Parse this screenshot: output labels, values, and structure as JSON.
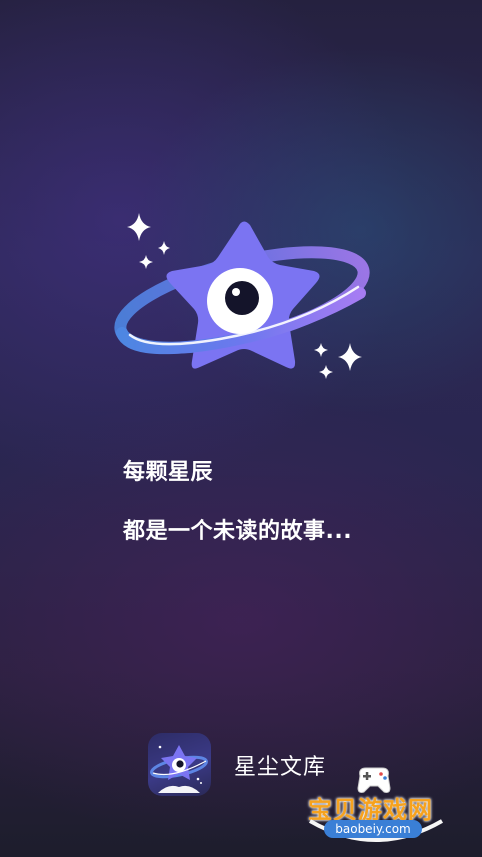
{
  "splash": {
    "tagline_line1": "每颗星辰",
    "tagline_line2": "都是一个未读的故事..."
  },
  "brand": {
    "app_name": "星尘文库"
  },
  "watermark": {
    "title": "宝贝游戏网",
    "url": "baobeiy.com"
  },
  "icons": {
    "hero": "star-planet-eye-logo",
    "app_icon": "star-planet-app-icon",
    "watermark_icon": "gamepad-icon"
  },
  "colors": {
    "star": "#7b74f2",
    "ring_blue": "#4f7fe0",
    "ring_purple": "#9a7cf0",
    "text": "#ffffff",
    "watermark_orange": "#f6a21e"
  }
}
